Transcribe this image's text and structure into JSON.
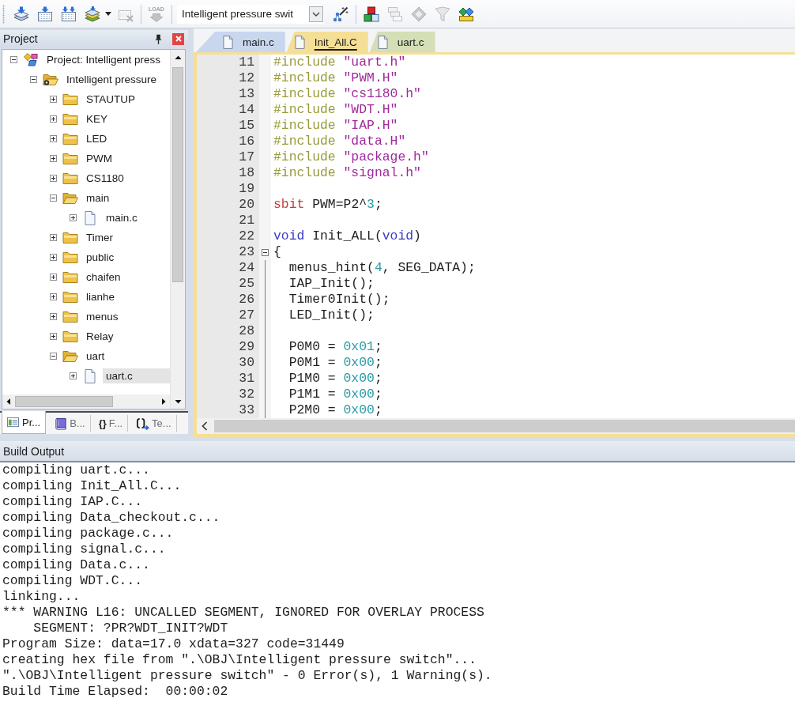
{
  "toolbar": {
    "groups": [
      {
        "items": [
          {
            "kind": "layers-arrow",
            "disabled": false
          },
          {
            "kind": "grid-arrow",
            "disabled": false
          },
          {
            "kind": "grid-double-arrow",
            "disabled": false
          },
          {
            "kind": "stack",
            "disabled": false
          },
          {
            "kind": "caret",
            "disabled": false
          },
          {
            "kind": "grid-cross",
            "disabled": true
          }
        ]
      },
      {
        "items": [
          {
            "kind": "load",
            "label": "LOAD",
            "disabled": true
          }
        ]
      },
      {
        "items": [
          {
            "kind": "select",
            "value": "Intelligent pressure swit",
            "disabled": false
          },
          {
            "kind": "wand",
            "disabled": false
          }
        ]
      },
      {
        "items": [
          {
            "kind": "cubes",
            "disabled": false
          },
          {
            "kind": "windows",
            "disabled": true
          },
          {
            "kind": "diamond",
            "disabled": true
          },
          {
            "kind": "funnel",
            "disabled": true
          },
          {
            "kind": "diamonds",
            "disabled": false
          }
        ]
      }
    ]
  },
  "project_panel": {
    "title": "Project",
    "tree": [
      {
        "kind": "project",
        "label": "Project: Intelligent press",
        "expanded": true,
        "selected": false,
        "children": [
          {
            "kind": "target",
            "label": "Intelligent pressure",
            "expanded": true,
            "selected": false,
            "children": [
              {
                "kind": "group",
                "label": "STAUTUP",
                "expanded": false,
                "selected": false
              },
              {
                "kind": "group",
                "label": "KEY",
                "expanded": false,
                "selected": false
              },
              {
                "kind": "group",
                "label": "LED",
                "expanded": false,
                "selected": false
              },
              {
                "kind": "group",
                "label": "PWM",
                "expanded": false,
                "selected": false
              },
              {
                "kind": "group",
                "label": "CS1180",
                "expanded": false,
                "selected": false
              },
              {
                "kind": "group",
                "label": "main",
                "expanded": true,
                "selected": false,
                "children": [
                  {
                    "kind": "file",
                    "label": "main.c",
                    "expanded": false,
                    "selected": false
                  }
                ]
              },
              {
                "kind": "group",
                "label": "Timer",
                "expanded": false,
                "selected": false
              },
              {
                "kind": "group",
                "label": "public",
                "expanded": false,
                "selected": false
              },
              {
                "kind": "group",
                "label": "chaifen",
                "expanded": false,
                "selected": false
              },
              {
                "kind": "group",
                "label": "lianhe",
                "expanded": false,
                "selected": false
              },
              {
                "kind": "group",
                "label": "menus",
                "expanded": false,
                "selected": false
              },
              {
                "kind": "group",
                "label": "Relay",
                "expanded": false,
                "selected": false
              },
              {
                "kind": "group",
                "label": "uart",
                "expanded": true,
                "selected": false,
                "children": [
                  {
                    "kind": "file",
                    "label": "uart.c",
                    "expanded": false,
                    "selected": true
                  }
                ]
              }
            ]
          }
        ]
      }
    ],
    "tabs": [
      {
        "kind": "project",
        "label": "Pr...",
        "selected": true
      },
      {
        "kind": "books",
        "label": "B...",
        "selected": false
      },
      {
        "kind": "functions",
        "glyph": "{}",
        "label": "F...",
        "selected": false
      },
      {
        "kind": "templates",
        "label": "Te...",
        "selected": false
      }
    ]
  },
  "editor": {
    "tabs": [
      {
        "label": "main.c",
        "color": "#c9d7ee",
        "selected": false
      },
      {
        "label": "Init_All.C",
        "color": "#f5df97",
        "selected": true
      },
      {
        "label": "uart.c",
        "color": "#d4dfb7",
        "selected": false
      }
    ],
    "lines": [
      {
        "number": "11",
        "fold_toggle": false,
        "tokens": [
          {
            "kind": "directive",
            "text": "#include "
          },
          {
            "kind": "string",
            "text": "\"uart.h\""
          }
        ]
      },
      {
        "number": "12",
        "fold_toggle": false,
        "tokens": [
          {
            "kind": "directive",
            "text": "#include "
          },
          {
            "kind": "string",
            "text": "\"PWM.H\""
          }
        ]
      },
      {
        "number": "13",
        "fold_toggle": false,
        "tokens": [
          {
            "kind": "directive",
            "text": "#include "
          },
          {
            "kind": "string",
            "text": "\"cs1180.h\""
          }
        ]
      },
      {
        "number": "14",
        "fold_toggle": false,
        "tokens": [
          {
            "kind": "directive",
            "text": "#include "
          },
          {
            "kind": "string",
            "text": "\"WDT.H\""
          }
        ]
      },
      {
        "number": "15",
        "fold_toggle": false,
        "tokens": [
          {
            "kind": "directive",
            "text": "#include "
          },
          {
            "kind": "string",
            "text": "\"IAP.H\""
          }
        ]
      },
      {
        "number": "16",
        "fold_toggle": false,
        "tokens": [
          {
            "kind": "directive",
            "text": "#include "
          },
          {
            "kind": "string",
            "text": "\"data.H\""
          }
        ]
      },
      {
        "number": "17",
        "fold_toggle": false,
        "tokens": [
          {
            "kind": "directive",
            "text": "#include "
          },
          {
            "kind": "string",
            "text": "\"package.h\""
          }
        ]
      },
      {
        "number": "18",
        "fold_toggle": false,
        "tokens": [
          {
            "kind": "directive",
            "text": "#include "
          },
          {
            "kind": "string",
            "text": "\"signal.h\""
          }
        ]
      },
      {
        "number": "19",
        "fold_toggle": false
      },
      {
        "number": "20",
        "fold_toggle": false,
        "tokens": [
          {
            "kind": "sfr",
            "text": "sbit"
          },
          {
            "kind": "plain",
            "text": " PWM=P2^"
          },
          {
            "kind": "number",
            "text": "3"
          },
          {
            "kind": "plain",
            "text": ";"
          }
        ]
      },
      {
        "number": "21",
        "fold_toggle": false
      },
      {
        "number": "22",
        "fold_toggle": false,
        "tokens": [
          {
            "kind": "keyword",
            "text": "void"
          },
          {
            "kind": "plain",
            "text": " Init_ALL("
          },
          {
            "kind": "keyword",
            "text": "void"
          },
          {
            "kind": "plain",
            "text": ")"
          }
        ]
      },
      {
        "number": "23",
        "fold_toggle": true,
        "tokens": [
          {
            "kind": "plain",
            "text": "{"
          }
        ]
      },
      {
        "number": "24",
        "fold_toggle": false,
        "tokens": [
          {
            "kind": "plain",
            "text": "  menus_hint("
          },
          {
            "kind": "number",
            "text": "4"
          },
          {
            "kind": "plain",
            "text": ", SEG_DATA);"
          }
        ]
      },
      {
        "number": "25",
        "fold_toggle": false,
        "tokens": [
          {
            "kind": "plain",
            "text": "  IAP_Init();"
          }
        ]
      },
      {
        "number": "26",
        "fold_toggle": false,
        "tokens": [
          {
            "kind": "plain",
            "text": "  Timer0Init();"
          }
        ]
      },
      {
        "number": "27",
        "fold_toggle": false,
        "tokens": [
          {
            "kind": "plain",
            "text": "  LED_Init();"
          }
        ]
      },
      {
        "number": "28",
        "fold_toggle": false
      },
      {
        "number": "29",
        "fold_toggle": false,
        "tokens": [
          {
            "kind": "plain",
            "text": "  P0M0 = "
          },
          {
            "kind": "number",
            "text": "0x01"
          },
          {
            "kind": "plain",
            "text": ";"
          }
        ]
      },
      {
        "number": "30",
        "fold_toggle": false,
        "tokens": [
          {
            "kind": "plain",
            "text": "  P0M1 = "
          },
          {
            "kind": "number",
            "text": "0x00"
          },
          {
            "kind": "plain",
            "text": ";"
          }
        ]
      },
      {
        "number": "31",
        "fold_toggle": false,
        "tokens": [
          {
            "kind": "plain",
            "text": "  P1M0 = "
          },
          {
            "kind": "number",
            "text": "0x00"
          },
          {
            "kind": "plain",
            "text": ";"
          }
        ]
      },
      {
        "number": "32",
        "fold_toggle": false,
        "tokens": [
          {
            "kind": "plain",
            "text": "  P1M1 = "
          },
          {
            "kind": "number",
            "text": "0x00"
          },
          {
            "kind": "plain",
            "text": ";"
          }
        ]
      },
      {
        "number": "33",
        "fold_toggle": false,
        "tokens": [
          {
            "kind": "plain",
            "text": "  P2M0 = "
          },
          {
            "kind": "number",
            "text": "0x00"
          },
          {
            "kind": "plain",
            "text": ";"
          }
        ]
      }
    ]
  },
  "build_output": {
    "title": "Build Output",
    "lines": [
      "compiling uart.c...",
      "compiling Init_All.C...",
      "compiling IAP.C...",
      "compiling Data_checkout.c...",
      "compiling package.c...",
      "compiling signal.c...",
      "compiling Data.c...",
      "compiling WDT.C...",
      "linking...",
      "*** WARNING L16: UNCALLED SEGMENT, IGNORED FOR OVERLAY PROCESS",
      "    SEGMENT: ?PR?WDT_INIT?WDT",
      "Program Size: data=17.0 xdata=327 code=31449",
      "creating hex file from \".\\OBJ\\Intelligent pressure switch\"...",
      "\".\\OBJ\\Intelligent pressure switch\" - 0 Error(s), 1 Warning(s).",
      "Build Time Elapsed:  00:00:02"
    ]
  }
}
